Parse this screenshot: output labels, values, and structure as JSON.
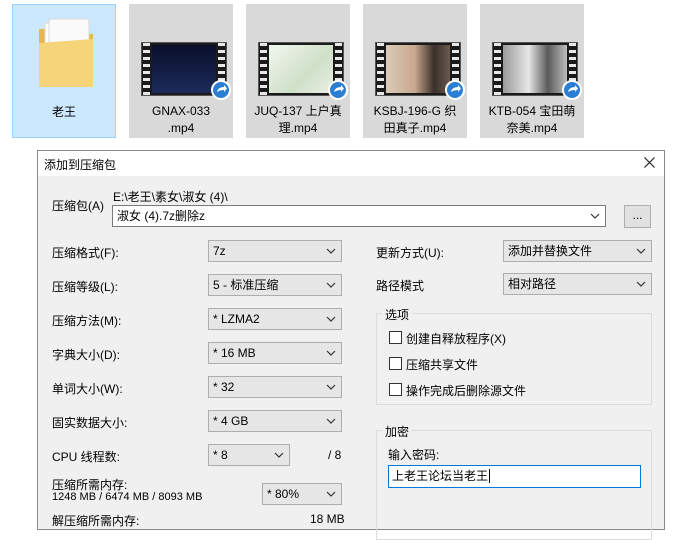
{
  "explorer": {
    "folder": {
      "label": "老王"
    },
    "files": [
      {
        "label": "GNAX-033\n.mp4"
      },
      {
        "label": "JUQ-137 上户真\n理.mp4"
      },
      {
        "label": "KSBJ-196-G 织\n田真子.mp4"
      },
      {
        "label": "KTB-054 宝田萌\n奈美.mp4"
      }
    ]
  },
  "dialog": {
    "title": "添加到压缩包",
    "archive": {
      "label": "压缩包(A)",
      "path": "E:\\老王\\素女\\淑女 (4)\\",
      "value": "淑女 (4).7z删除z",
      "browse_label": "..."
    },
    "left": {
      "format": {
        "label": "压缩格式(F):",
        "value": "7z"
      },
      "level": {
        "label": "压缩等级(L):",
        "value": "5 - 标准压缩"
      },
      "method": {
        "label": "压缩方法(M):",
        "value": "* LZMA2"
      },
      "dict": {
        "label": "字典大小(D):",
        "value": "* 16 MB"
      },
      "word": {
        "label": "单词大小(W):",
        "value": "* 32"
      },
      "solid": {
        "label": "固实数据大小:",
        "value": "* 4 GB"
      },
      "threads": {
        "label": "CPU 线程数:",
        "value": "* 8",
        "max": "/ 8"
      },
      "memory": {
        "label": "压缩所需内存:",
        "detail": "1248 MB / 6474 MB / 8093 MB",
        "value": "* 80%"
      },
      "decompress_memory": {
        "label": "解压缩所需内存:",
        "value": "18 MB"
      }
    },
    "right": {
      "update": {
        "label": "更新方式(U):",
        "value": "添加并替换文件"
      },
      "pathmode": {
        "label": "路径模式",
        "value": "相对路径"
      },
      "options": {
        "title": "选项",
        "sfx": "创建自释放程序(X)",
        "shared": "压缩共享文件",
        "delete": "操作完成后删除源文件"
      },
      "encryption": {
        "title": "加密",
        "password_label": "输入密码:",
        "password_value": "上老王论坛当老王"
      }
    }
  }
}
